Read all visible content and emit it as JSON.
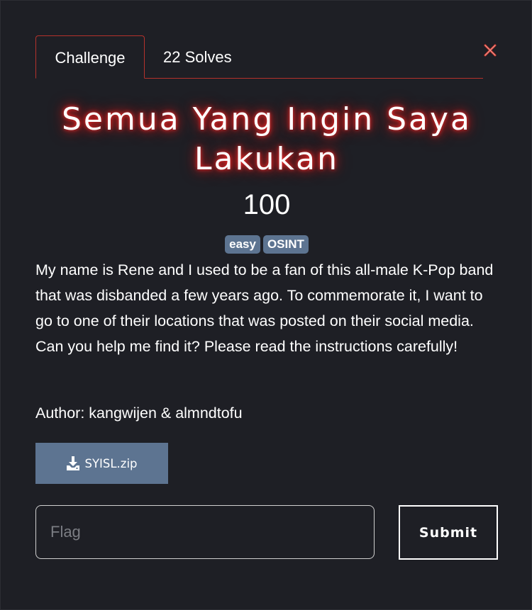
{
  "modal": {
    "tabs": [
      {
        "label": "Challenge",
        "active": true
      },
      {
        "label": "22 Solves",
        "active": false
      }
    ],
    "close_icon": "close-icon",
    "accent_color": "#b5322c"
  },
  "challenge": {
    "title": "Semua Yang Ingin Saya Lakukan",
    "points": "100",
    "tags": [
      "easy",
      "OSINT"
    ],
    "description": "My name is Rene and I used to be a fan of this all-male K-Pop band that was disbanded a few years ago. To commemorate it, I want to go to one of their locations that was posted on their social media. Can you help me find it? Please read the instructions carefully!",
    "author": "Author: kangwijen & almndtofu"
  },
  "attachment": {
    "filename": "SYISL.zip",
    "icon": "download-icon"
  },
  "flag_form": {
    "placeholder": "Flag",
    "value": "",
    "submit_label": "Submit"
  }
}
